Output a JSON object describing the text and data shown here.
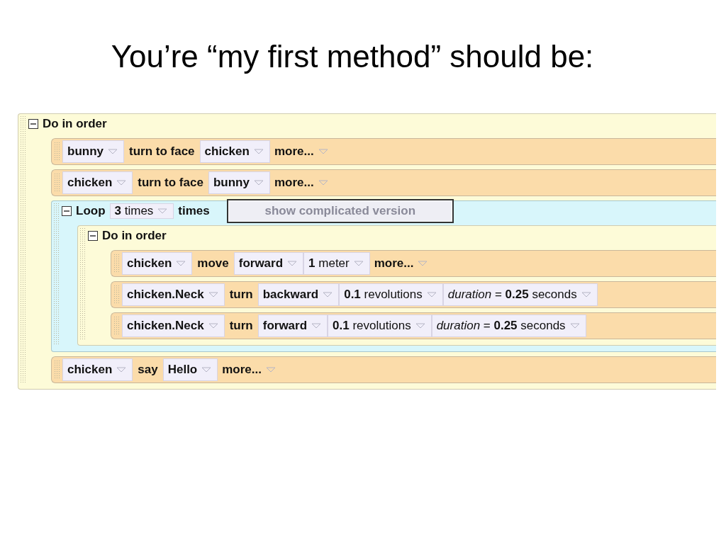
{
  "title": "You’re “my first method” should be:",
  "method": {
    "kind": "block",
    "label": "Do in order",
    "expanded": true,
    "children": [
      {
        "kind": "statement",
        "parts": [
          {
            "kind": "dropdown",
            "text": "bunny"
          },
          {
            "kind": "word",
            "text": "turn to face"
          },
          {
            "kind": "dropdown",
            "text": "chicken"
          },
          {
            "kind": "more",
            "text": "more..."
          }
        ]
      },
      {
        "kind": "statement",
        "parts": [
          {
            "kind": "dropdown",
            "text": "chicken"
          },
          {
            "kind": "word",
            "text": "turn to face"
          },
          {
            "kind": "dropdown",
            "text": "bunny"
          },
          {
            "kind": "more",
            "text": "more..."
          }
        ]
      },
      {
        "kind": "loop",
        "label": "Loop",
        "expanded": true,
        "count": "**3** times",
        "suffix": "times",
        "button": "show complicated version",
        "children": [
          {
            "kind": "block",
            "label": "Do in order",
            "expanded": true,
            "children": [
              {
                "kind": "statement",
                "parts": [
                  {
                    "kind": "dropdown",
                    "text": "chicken"
                  },
                  {
                    "kind": "word",
                    "text": "move"
                  },
                  {
                    "kind": "dropdown",
                    "text": "forward"
                  },
                  {
                    "kind": "value",
                    "text": "**1** meter"
                  },
                  {
                    "kind": "more",
                    "text": "more..."
                  }
                ]
              },
              {
                "kind": "statement",
                "parts": [
                  {
                    "kind": "dropdown",
                    "text": "chicken.Neck"
                  },
                  {
                    "kind": "word",
                    "text": "turn"
                  },
                  {
                    "kind": "dropdown",
                    "text": "backward"
                  },
                  {
                    "kind": "value",
                    "text": "**0.1** revolutions"
                  },
                  {
                    "kind": "value",
                    "text": "*duration* = **0.25** seconds"
                  }
                ]
              },
              {
                "kind": "statement",
                "parts": [
                  {
                    "kind": "dropdown",
                    "text": "chicken.Neck"
                  },
                  {
                    "kind": "word",
                    "text": "turn"
                  },
                  {
                    "kind": "dropdown",
                    "text": "forward"
                  },
                  {
                    "kind": "value",
                    "text": "**0.1** revolutions"
                  },
                  {
                    "kind": "value",
                    "text": "*duration* = **0.25** seconds"
                  }
                ]
              }
            ]
          }
        ]
      },
      {
        "kind": "statement",
        "parts": [
          {
            "kind": "dropdown",
            "text": "chicken"
          },
          {
            "kind": "word",
            "text": "say"
          },
          {
            "kind": "dropdown",
            "text": "Hello"
          },
          {
            "kind": "more",
            "text": "more..."
          }
        ]
      }
    ]
  }
}
